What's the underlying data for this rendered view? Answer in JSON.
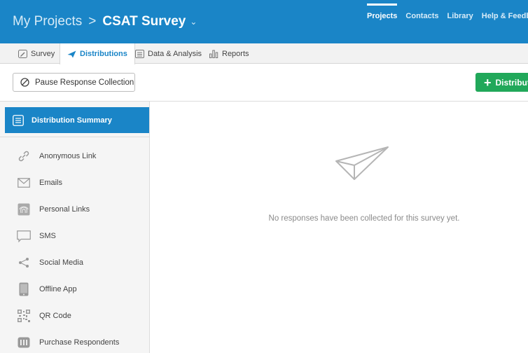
{
  "header": {
    "breadcrumb_root": "My Projects",
    "breadcrumb_separator": ">",
    "project_name": "CSAT Survey",
    "nav": [
      "Projects",
      "Contacts",
      "Library",
      "Help & Feedback"
    ]
  },
  "tabs": [
    {
      "label": "Survey",
      "icon": "pencil-icon"
    },
    {
      "label": "Distributions",
      "icon": "paper-plane-icon"
    },
    {
      "label": "Data & Analysis",
      "icon": "list-icon"
    },
    {
      "label": "Reports",
      "icon": "bar-chart-icon"
    }
  ],
  "toolbar": {
    "pause_label": "Pause Response Collection",
    "distribute_label": "Distribute"
  },
  "sidebar": {
    "summary": "Distribution Summary",
    "items": [
      {
        "label": "Anonymous Link",
        "icon": "link-icon"
      },
      {
        "label": "Emails",
        "icon": "envelope-icon"
      },
      {
        "label": "Personal Links",
        "icon": "fingerprint-icon"
      },
      {
        "label": "SMS",
        "icon": "chat-bubble-icon"
      },
      {
        "label": "Social Media",
        "icon": "share-icon"
      },
      {
        "label": "Offline App",
        "icon": "tablet-icon"
      },
      {
        "label": "QR Code",
        "icon": "qr-code-icon"
      },
      {
        "label": "Purchase Respondents",
        "icon": "people-icon"
      }
    ]
  },
  "main": {
    "empty_message": "No responses have been collected for this survey yet.",
    "empty_icon": "paper-plane-icon"
  },
  "colors": {
    "brand_blue": "#1a85c7",
    "action_green": "#21a85a"
  }
}
